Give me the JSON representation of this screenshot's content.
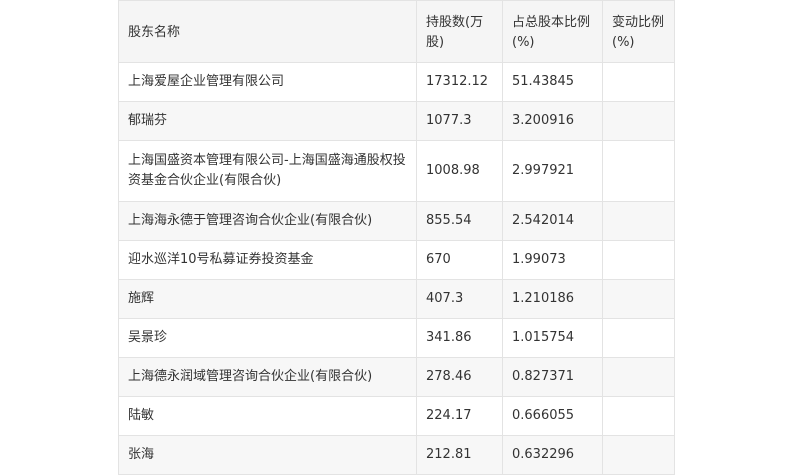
{
  "table": {
    "headers": [
      "股东名称",
      "持股数(万股)",
      "占总股本比例(%)",
      "变动比例(%)"
    ],
    "rows": [
      [
        "上海爱屋企业管理有限公司",
        "17312.12",
        "51.43845",
        ""
      ],
      [
        "郁瑞芬",
        "1077.3",
        "3.200916",
        ""
      ],
      [
        "上海国盛资本管理有限公司-上海国盛海通股权投资基金合伙企业(有限合伙)",
        "1008.98",
        "2.997921",
        ""
      ],
      [
        "上海海永德于管理咨询合伙企业(有限合伙)",
        "855.54",
        "2.542014",
        ""
      ],
      [
        "迎水巡洋10号私募证券投资基金",
        "670",
        "1.99073",
        ""
      ],
      [
        "施辉",
        "407.3",
        "1.210186",
        ""
      ],
      [
        "吴景珍",
        "341.86",
        "1.015754",
        ""
      ],
      [
        "上海德永润域管理咨询合伙企业(有限合伙)",
        "278.46",
        "0.827371",
        ""
      ],
      [
        "陆敏",
        "224.17",
        "0.666055",
        ""
      ],
      [
        "张海",
        "212.81",
        "0.632296",
        ""
      ]
    ]
  }
}
